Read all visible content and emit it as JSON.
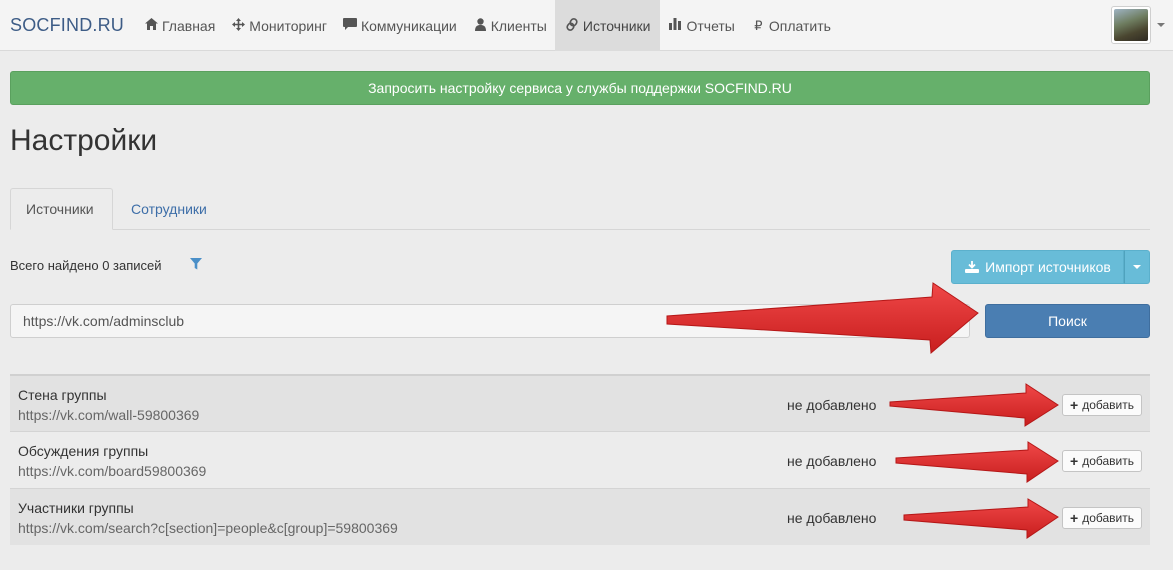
{
  "navbar": {
    "brand": "SOCFIND.RU",
    "items": [
      {
        "label": "Главная",
        "icon": "home-icon"
      },
      {
        "label": "Мониторинг",
        "icon": "move-icon"
      },
      {
        "label": "Коммуникации",
        "icon": "comment-icon"
      },
      {
        "label": "Клиенты",
        "icon": "user-icon"
      },
      {
        "label": "Источники",
        "icon": "link-icon",
        "active": true
      },
      {
        "label": "Отчеты",
        "icon": "bar-chart-icon"
      },
      {
        "label": "Оплатить",
        "icon": "ruble-icon"
      }
    ]
  },
  "support_button": "Запросить настройку сервиса у службы поддержки SOCFIND.RU",
  "page_title": "Настройки",
  "tabs": [
    {
      "label": "Источники",
      "active": true
    },
    {
      "label": "Сотрудники",
      "active": false
    }
  ],
  "results_count": "Всего найдено 0 записей",
  "import_button": "Импорт источников",
  "search": {
    "value": "https://vk.com/adminsclub",
    "button": "Поиск"
  },
  "results": [
    {
      "title": "Стена группы",
      "url": "https://vk.com/wall-59800369",
      "status": "не добавлено",
      "action": "добавить"
    },
    {
      "title": "Обсуждения группы",
      "url": "https://vk.com/board59800369",
      "status": "не добавлено",
      "action": "добавить"
    },
    {
      "title": "Участники группы",
      "url": "https://vk.com/search?c[section]=people&c[group]=59800369",
      "status": "не добавлено",
      "action": "добавить"
    }
  ],
  "colors": {
    "success": "#66b06b",
    "info": "#68bcd8",
    "primary": "#4a7eb2",
    "annotation": "#e03131"
  }
}
